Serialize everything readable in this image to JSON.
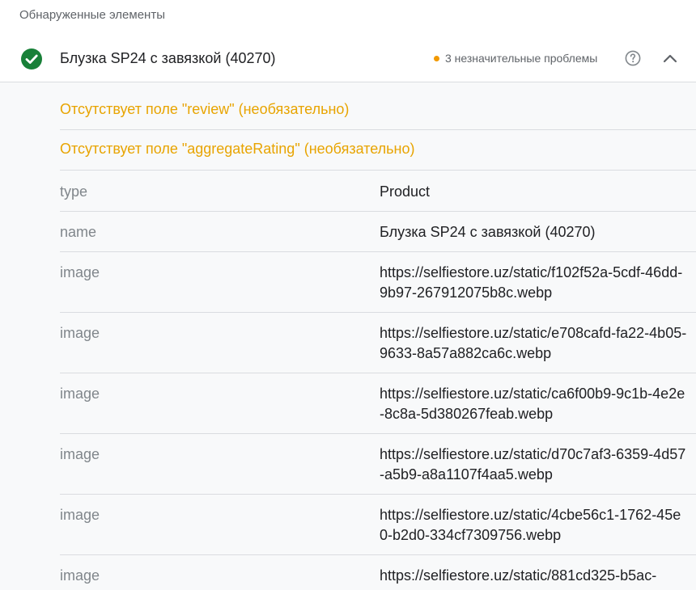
{
  "section": {
    "title": "Обнаруженные элементы"
  },
  "item": {
    "title": "Блузка SP24 с завязкой (40270)",
    "status_icon": "check-circle-icon",
    "issues_label": "3 незначительные проблемы",
    "issues_color": "#f29900",
    "help_icon": "help-circle-icon",
    "collapse_icon": "chevron-up-icon"
  },
  "warnings": [
    "Отсутствует поле \"review\" (необязательно)",
    "Отсутствует поле \"aggregateRating\" (необязательно)"
  ],
  "properties": [
    {
      "key": "type",
      "value": "Product"
    },
    {
      "key": "name",
      "value": "Блузка SP24 с завязкой (40270)"
    },
    {
      "key": "image",
      "value": "https://selfiestore.uz/static/f102f52a-5cdf-46dd-9b97-267912075b8c.webp"
    },
    {
      "key": "image",
      "value": "https://selfiestore.uz/static/e708cafd-fa22-4b05-9633-8a57a882ca6c.webp"
    },
    {
      "key": "image",
      "value": "https://selfiestore.uz/static/ca6f00b9-9c1b-4e2e-8c8a-5d380267feab.webp"
    },
    {
      "key": "image",
      "value": "https://selfiestore.uz/static/d70c7af3-6359-4d57-a5b9-a8a1107f4aa5.webp"
    },
    {
      "key": "image",
      "value": "https://selfiestore.uz/static/4cbe56c1-1762-45e0-b2d0-334cf7309756.webp"
    },
    {
      "key": "image",
      "value": "https://selfiestore.uz/static/881cd325-b5ac-"
    }
  ],
  "colors": {
    "success": "#188038",
    "warning_text": "#e8a400"
  }
}
